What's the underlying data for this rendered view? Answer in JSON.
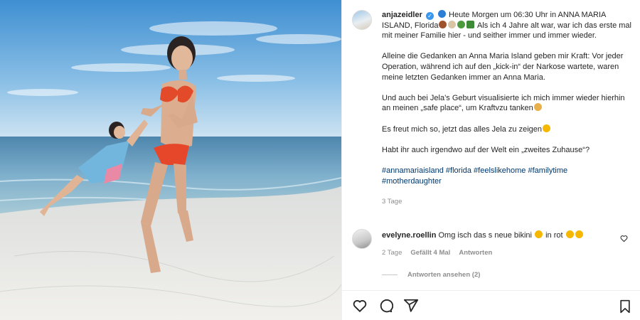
{
  "post": {
    "username": "anjazeidler",
    "caption_intro": "Heute Morgen um 06:30 Uhr in ANNA MARIA ISLAND, Florida",
    "caption_rest": "Als ich 4 Jahre alt war, war ich das erste mal mit meiner Familie hier - und seither immer und immer wieder.",
    "paragraph_2": "Alleine die Gedanken an Anna Maria Island geben mir Kraft: Vor jeder Operation, während ich auf den „kick-in“ der Narkose wartete, waren meine letzten Gedanken immer an Anna Maria.",
    "paragraph_3": "Und auch bei Jela’s Geburt visualisierte ich mich immer wieder hierhin an meinen „safe place“, um Kraftvzu tanken",
    "paragraph_4": "Es freut mich so, jetzt das alles Jela zu zeigen",
    "paragraph_5": "Habt ihr auch irgendwo auf der Welt ein „zweites Zuhause“?",
    "hashtags": [
      "#annamariaisland",
      "#florida",
      "#feelslikehome",
      "#familytime",
      "#motherdaughter"
    ],
    "timestamp": "3 Tage"
  },
  "comment": {
    "username": "evelyne.roellin",
    "text_a": "Omg isch das s neue bikini",
    "text_b": "in rot",
    "age": "2 Tage",
    "likes": "Gefällt 4 Mal",
    "reply": "Antworten"
  },
  "replies_link": "Antworten ansehen (2)",
  "icons": [
    "verified-icon",
    "heart-icon",
    "comment-icon",
    "share-icon",
    "bookmark-icon"
  ],
  "colors": {
    "link": "#00376b",
    "muted": "#8e8e8e",
    "verified": "#3897f0"
  }
}
